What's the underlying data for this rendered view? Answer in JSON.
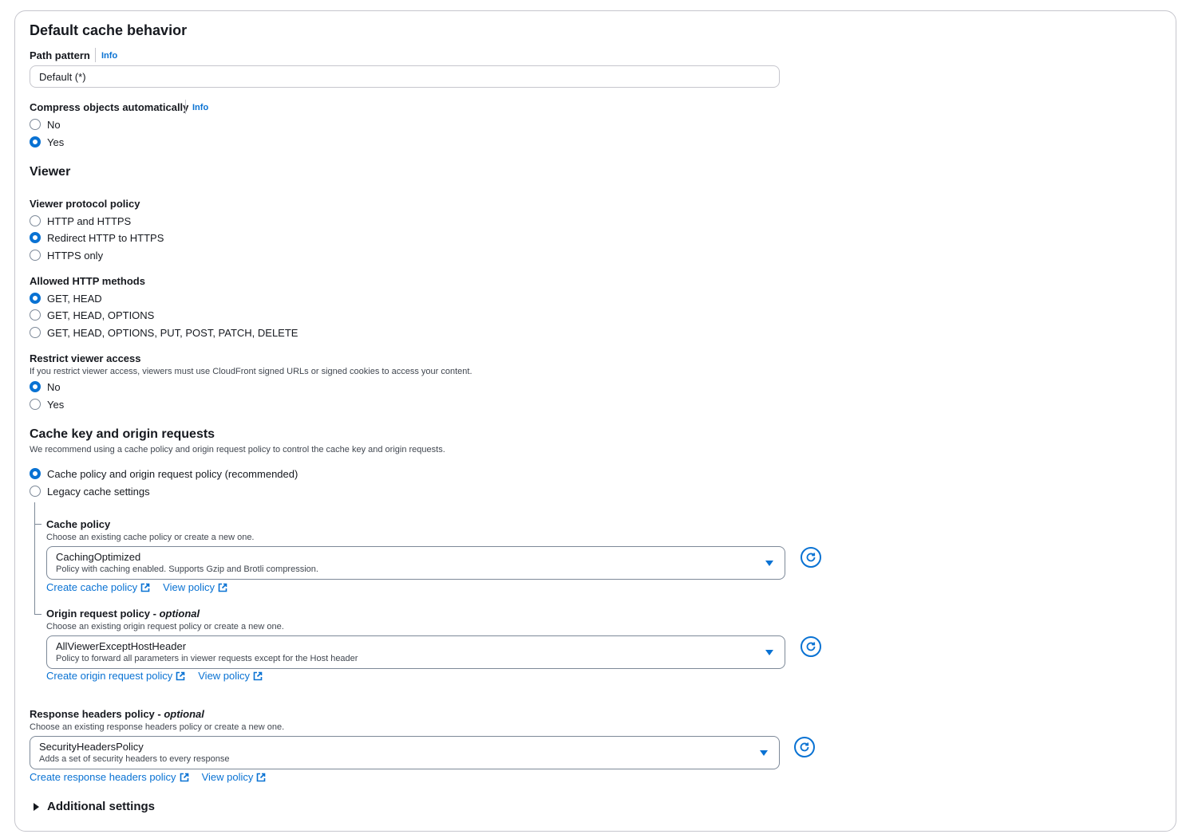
{
  "section": {
    "title": "Default cache behavior",
    "path_pattern": {
      "label": "Path pattern",
      "info": "Info",
      "value": "Default (*)"
    },
    "compress": {
      "label": "Compress objects automatically",
      "info": "Info",
      "options": [
        "No",
        "Yes"
      ],
      "selected": "Yes"
    }
  },
  "viewer": {
    "title": "Viewer",
    "protocol": {
      "label": "Viewer protocol policy",
      "options": [
        "HTTP and HTTPS",
        "Redirect HTTP to HTTPS",
        "HTTPS only"
      ],
      "selected": "Redirect HTTP to HTTPS"
    },
    "methods": {
      "label": "Allowed HTTP methods",
      "options": [
        "GET, HEAD",
        "GET, HEAD, OPTIONS",
        "GET, HEAD, OPTIONS, PUT, POST, PATCH, DELETE"
      ],
      "selected": "GET, HEAD"
    },
    "restrict": {
      "label": "Restrict viewer access",
      "description": "If you restrict viewer access, viewers must use CloudFront signed URLs or signed cookies to access your content.",
      "options": [
        "No",
        "Yes"
      ],
      "selected": "No"
    }
  },
  "cache_key": {
    "title": "Cache key and origin requests",
    "description": "We recommend using a cache policy and origin request policy to control the cache key and origin requests.",
    "options": [
      "Cache policy and origin request policy (recommended)",
      "Legacy cache settings"
    ],
    "selected": "Cache policy and origin request policy (recommended)",
    "cache_policy": {
      "label": "Cache policy",
      "description": "Choose an existing cache policy or create a new one.",
      "value": "CachingOptimized",
      "value_description": "Policy with caching enabled. Supports Gzip and Brotli compression.",
      "create_link": "Create cache policy",
      "view_link": "View policy"
    },
    "origin_policy": {
      "label": "Origin request policy - ",
      "label_optional": "optional",
      "description": "Choose an existing origin request policy or create a new one.",
      "value": "AllViewerExceptHostHeader",
      "value_description": "Policy to forward all parameters in viewer requests except for the Host header",
      "create_link": "Create origin request policy",
      "view_link": "View policy"
    }
  },
  "response_headers": {
    "label": "Response headers policy - ",
    "label_optional": "optional",
    "description": "Choose an existing response headers policy or create a new one.",
    "value": "SecurityHeadersPolicy",
    "value_description": "Adds a set of security headers to every response",
    "create_link": "Create response headers policy",
    "view_link": "View policy"
  },
  "additional_settings": "Additional settings",
  "colors": {
    "accent": "#0972d3",
    "text": "#16191f",
    "border": "#c6c6cd"
  },
  "icons": {
    "external": "external-link-icon",
    "refresh": "refresh-icon",
    "caret": "caret-down-icon",
    "expand": "caret-right-icon"
  }
}
